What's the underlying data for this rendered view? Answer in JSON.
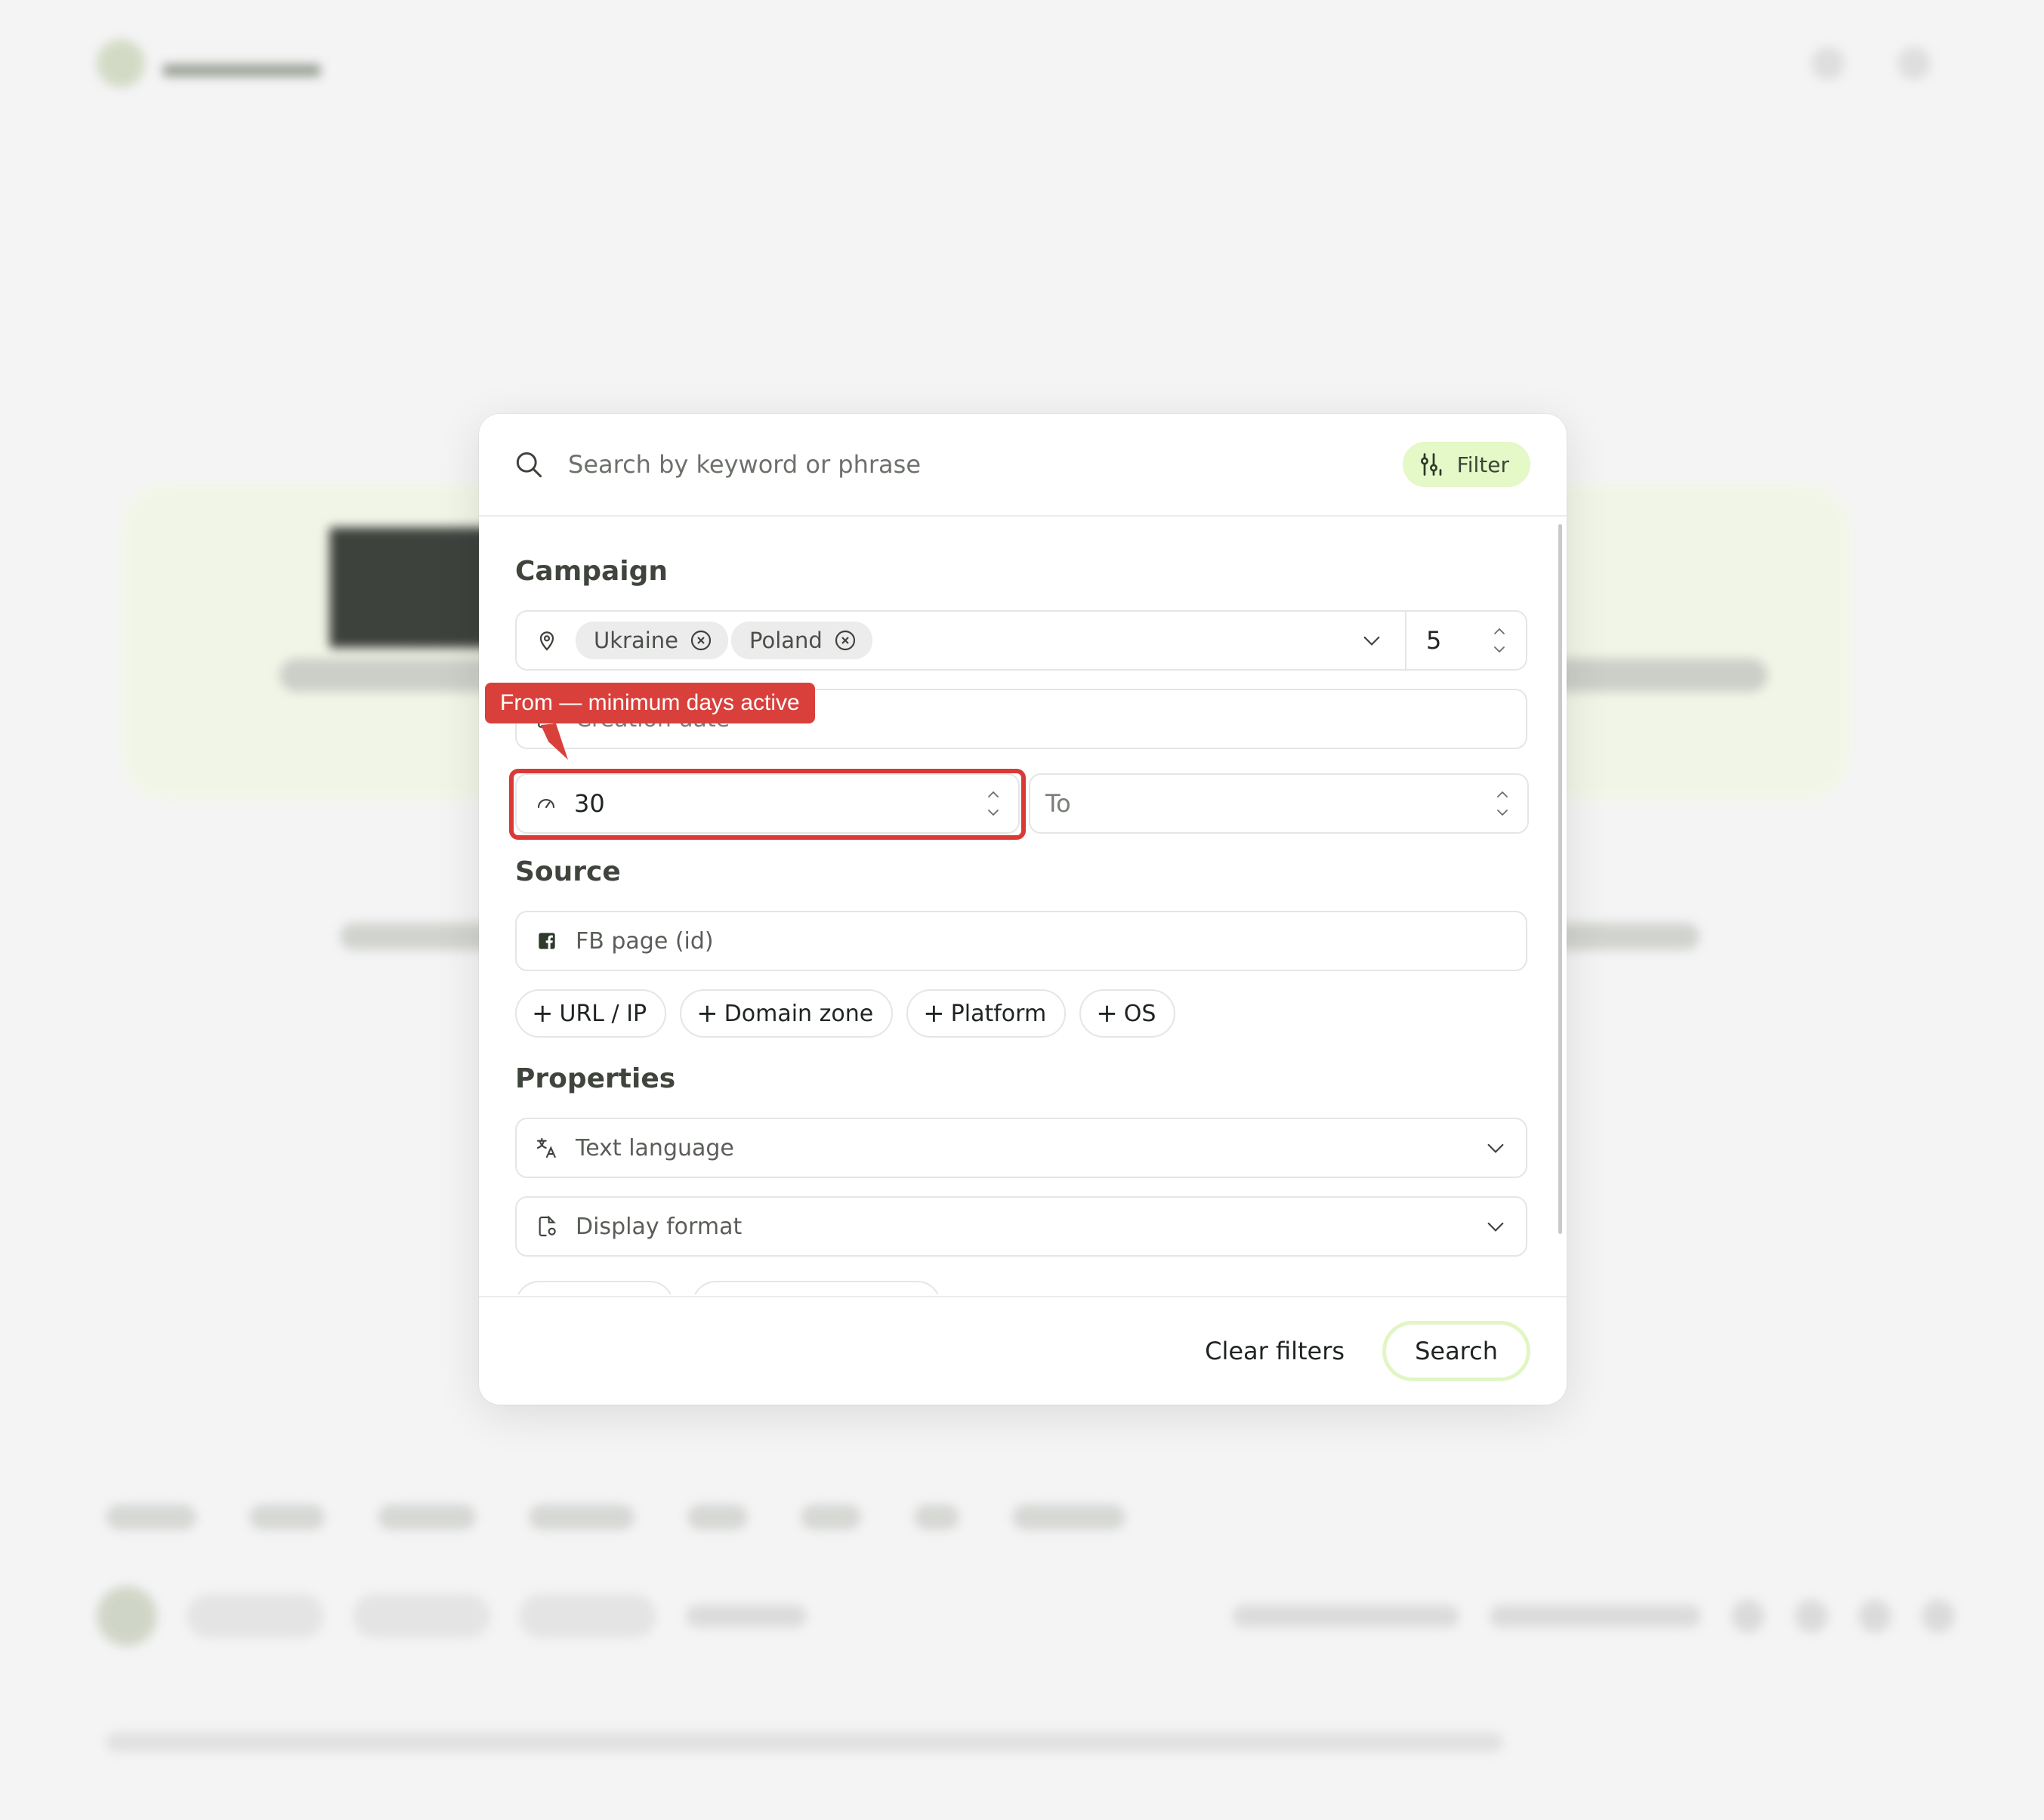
{
  "search": {
    "placeholder": "Search by keyword or phrase",
    "filter_label": "Filter"
  },
  "campaign": {
    "title": "Campaign",
    "geo_chips": [
      "Ukraine",
      "Poland"
    ],
    "geo_count": "5",
    "creation_date_placeholder": "Creation date",
    "days_from_value": "30",
    "days_to_placeholder": "To"
  },
  "tooltip": {
    "text": "From — minimum days active"
  },
  "source": {
    "title": "Source",
    "fb_page_placeholder": "FB page (id)",
    "add_chips": [
      "URL / IP",
      "Domain zone",
      "Platform",
      "OS"
    ]
  },
  "properties": {
    "title": "Properties",
    "text_language": "Text language",
    "display_format": "Display format"
  },
  "footer": {
    "clear_label": "Clear filters",
    "search_label": "Search"
  },
  "colors": {
    "accent": "#e4f8c8",
    "annotation_red": "#d9403b"
  }
}
